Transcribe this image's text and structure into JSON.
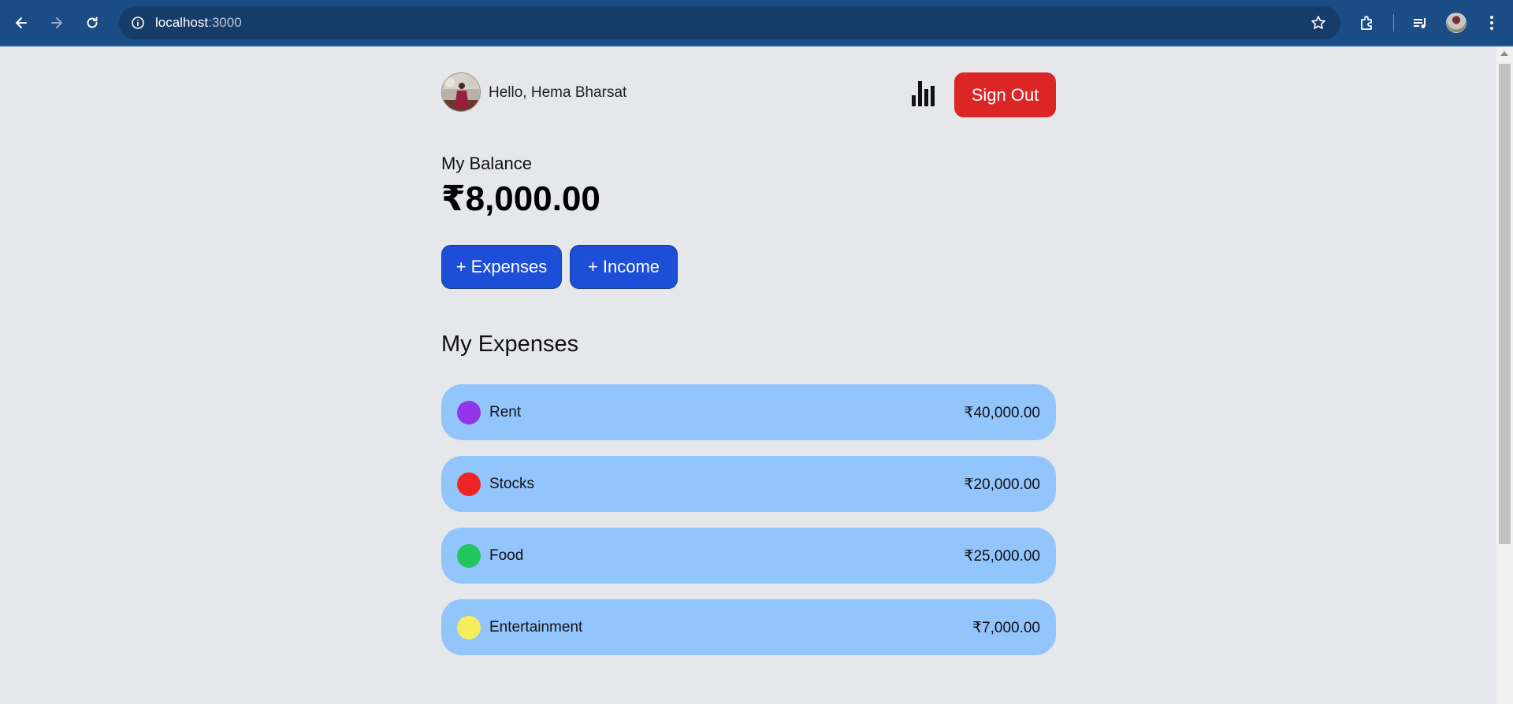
{
  "browser": {
    "url_host": "localhost",
    "url_port": ":3000"
  },
  "header": {
    "greeting": "Hello, Hema Bharsat",
    "signout_label": "Sign Out"
  },
  "balance": {
    "label": "My Balance",
    "amount": "₹8,000.00"
  },
  "actions": {
    "expenses_label": "+ Expenses",
    "income_label": "+ Income"
  },
  "expenses": {
    "title": "My Expenses",
    "items": [
      {
        "name": "Rent",
        "amount": "₹40,000.00",
        "color": "#9333ea"
      },
      {
        "name": "Stocks",
        "amount": "₹20,000.00",
        "color": "#ef2525"
      },
      {
        "name": "Food",
        "amount": "₹25,000.00",
        "color": "#22c55e"
      },
      {
        "name": "Entertainment",
        "amount": "₹7,000.00",
        "color": "#f5ed5b"
      }
    ]
  },
  "colors": {
    "chrome_bar": "#1a4c86",
    "page_bg": "#e5e7eb",
    "signout_bg": "#dc2626",
    "action_bg": "#1d4ed8",
    "expense_card_bg": "#93c5fd"
  }
}
